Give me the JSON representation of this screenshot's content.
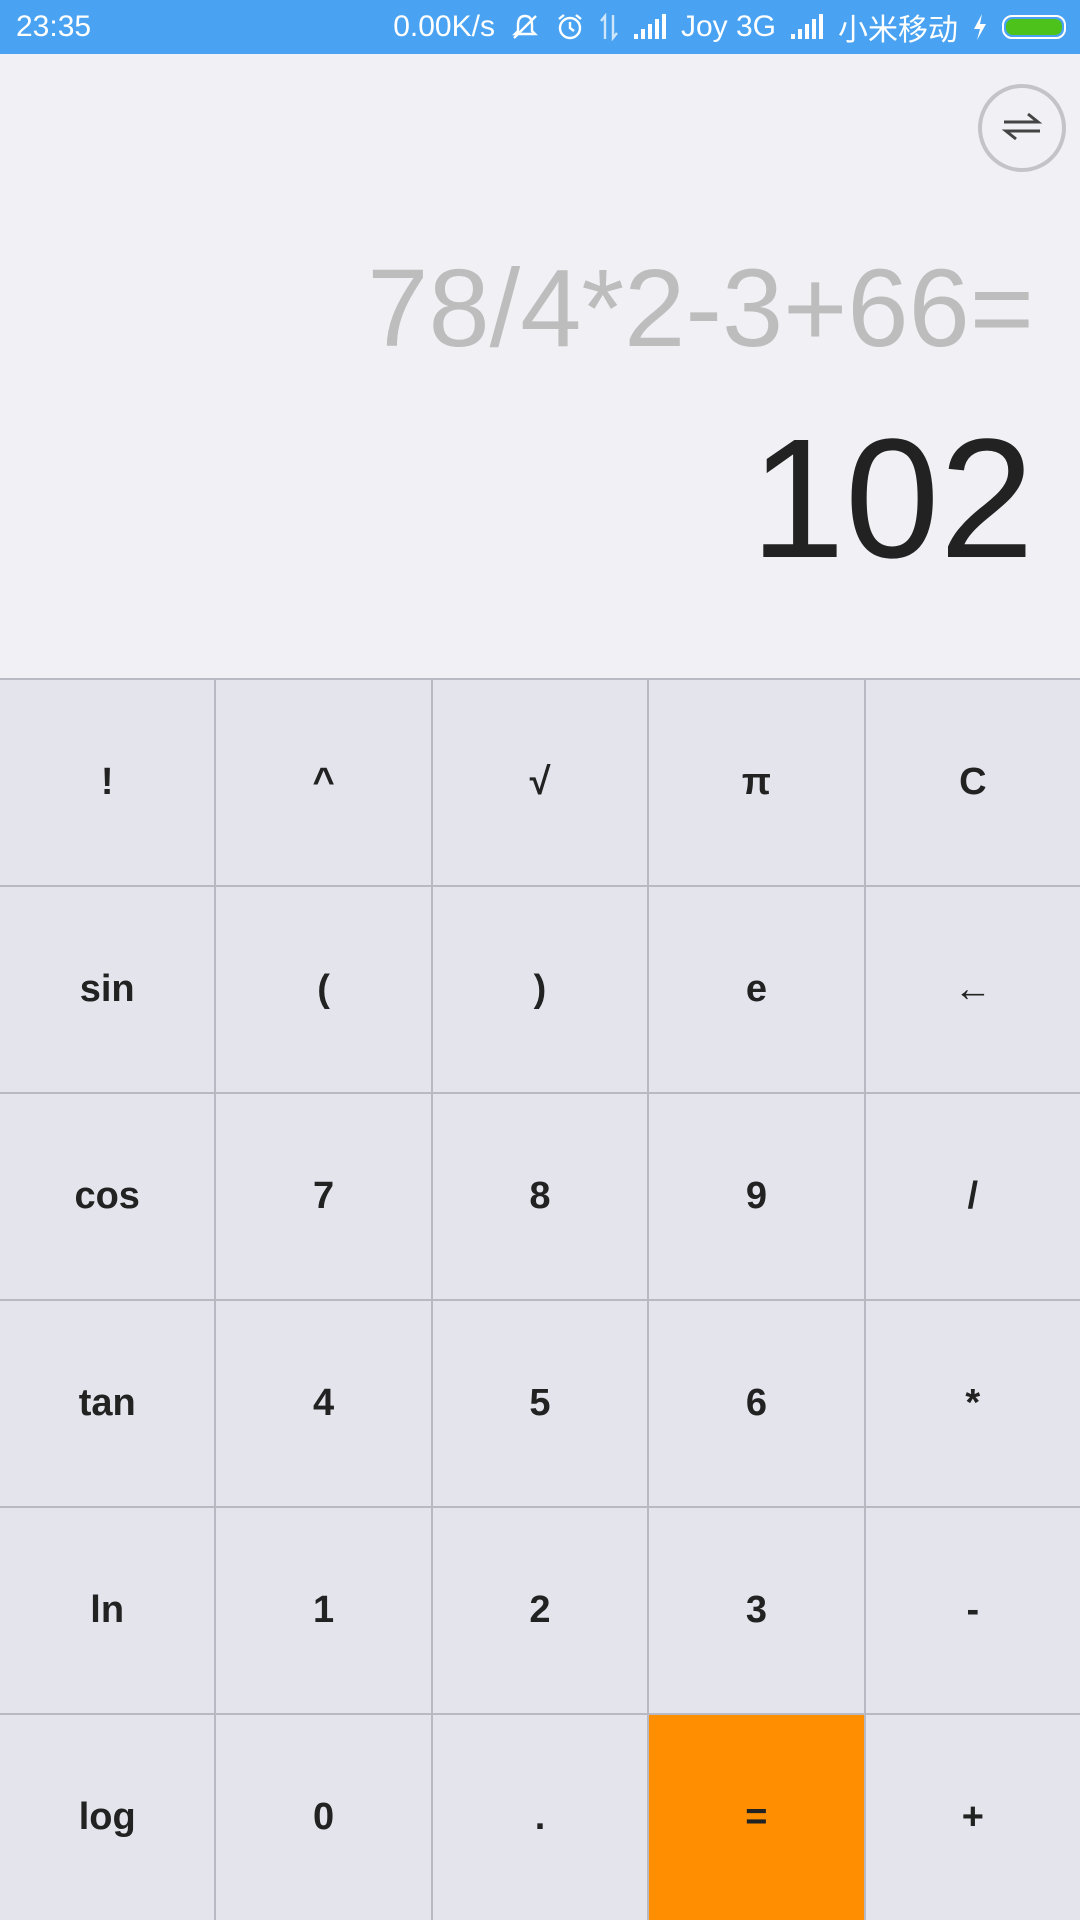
{
  "status_bar": {
    "time": "23:35",
    "network_speed": "0.00K/s",
    "carrier_1": "Joy 3G",
    "carrier_2": "小米移动",
    "icons": [
      "mute-icon",
      "alarm-icon",
      "data-transfer-icon",
      "signal-icon",
      "signal-icon",
      "charging-icon",
      "battery-icon"
    ],
    "battery_color": "#4cc21a",
    "bar_color": "#4aa3f2"
  },
  "display": {
    "mode_toggle_icon": "swap-arrows-icon",
    "expression": "78/4*2-3+66=",
    "result": "102"
  },
  "keypad": {
    "keys": [
      [
        "!",
        "^",
        "√",
        "π",
        "C"
      ],
      [
        "sin",
        "(",
        ")",
        "e",
        "←"
      ],
      [
        "cos",
        "7",
        "8",
        "9",
        "/"
      ],
      [
        "tan",
        "4",
        "5",
        "6",
        "*"
      ],
      [
        "ln",
        "1",
        "2",
        "3",
        "-"
      ],
      [
        "log",
        "0",
        ".",
        "=",
        "+"
      ]
    ],
    "equals_color": "#ff8f00"
  }
}
